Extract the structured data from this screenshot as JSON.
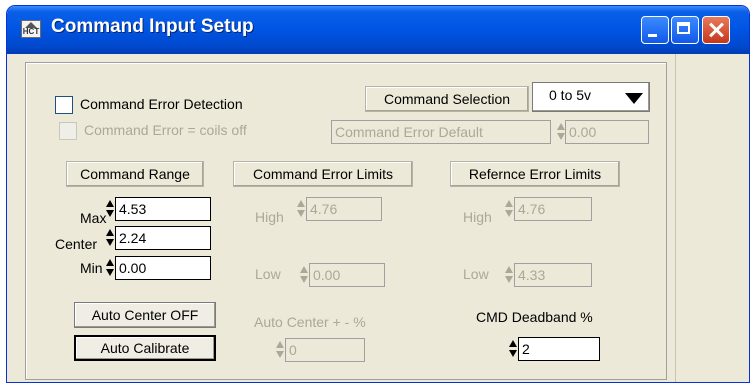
{
  "window": {
    "title": "Command Input Setup",
    "app_icon_text": "HCT"
  },
  "top": {
    "error_detection_label": "Command Error Detection",
    "error_detection_checked": false,
    "coils_off_label": "Command Error = coils off",
    "coils_off_checked": false,
    "selection_label": "Command  Selection",
    "selection_value": "0 to 5v",
    "error_default_label": "Command Error Default",
    "error_default_value": "0.00"
  },
  "command_range": {
    "header": "Command Range",
    "max_label": "Max",
    "max_value": "4.53",
    "center_label": "Center",
    "center_value": "2.24",
    "min_label": "Min",
    "min_value": "0.00"
  },
  "command_error_limits": {
    "header": "Command Error Limits",
    "high_label": "High",
    "high_value": "4.76",
    "low_label": "Low",
    "low_value": "0.00"
  },
  "reference_error_limits": {
    "header": "Refernce Error Limits",
    "high_label": "High",
    "high_value": "4.76",
    "low_label": "Low",
    "low_value": "4.33"
  },
  "bottom": {
    "auto_center_button": "Auto Center OFF",
    "auto_calibrate_button": "Auto Calibrate",
    "auto_center_pct_label": "Auto Center + - %",
    "auto_center_pct_value": "0",
    "deadband_label": "CMD Deadband %",
    "deadband_value": "2"
  }
}
